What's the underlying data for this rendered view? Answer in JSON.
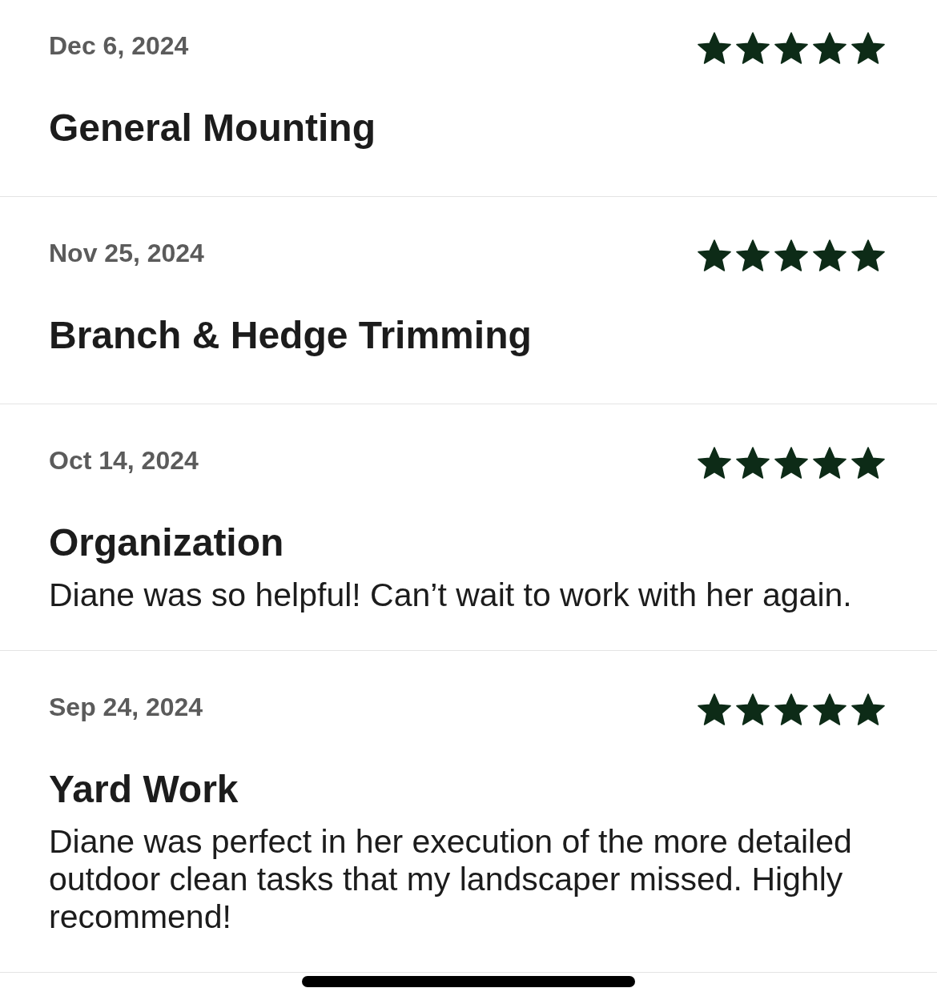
{
  "reviews": [
    {
      "date": "Dec 6, 2024",
      "stars": 5,
      "title": "General Mounting"
    },
    {
      "date": "Nov 25, 2024",
      "stars": 5,
      "title": "Branch & Hedge Trimming"
    },
    {
      "date": "Oct 14, 2024",
      "stars": 5,
      "title": "Organization",
      "body": "Diane was so helpful! Can’t wait to work with her again."
    },
    {
      "date": "Sep 24, 2024",
      "stars": 5,
      "title": "Yard Work",
      "body": "Diane was perfect in her execution of the more detailed outdoor clean tasks that my landscaper missed. Highly recommend!"
    }
  ]
}
